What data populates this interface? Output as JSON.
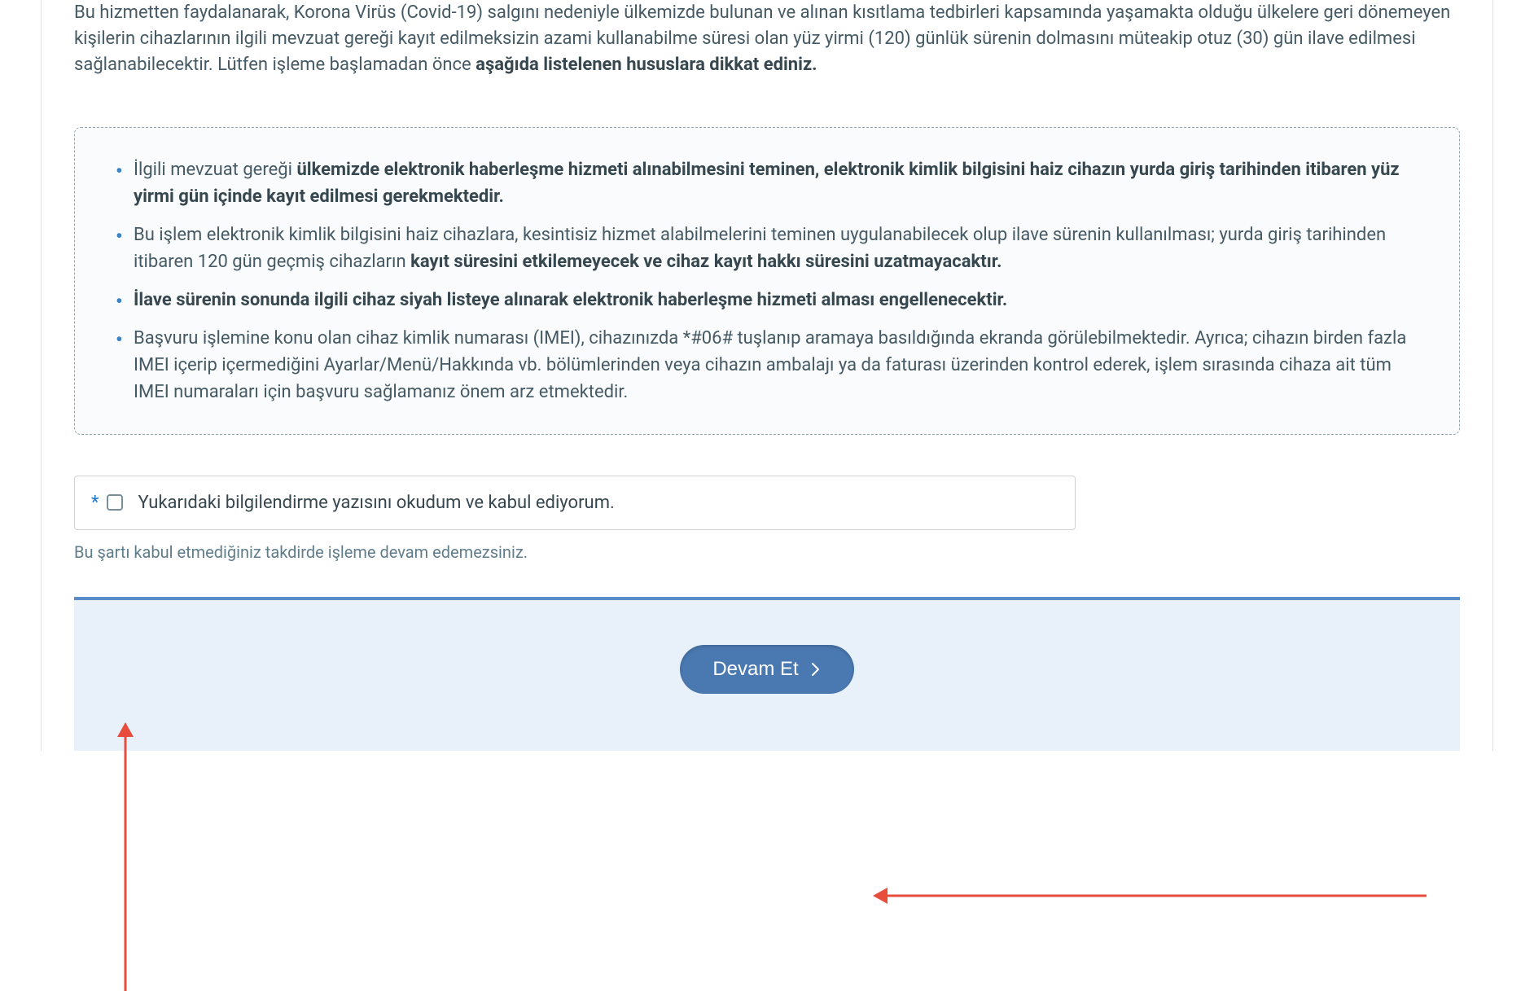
{
  "intro": {
    "text_prefix": "Bu hizmetten faydalanarak, Korona Virüs (Covid-19) salgını nedeniyle ülkemizde bulunan ve alınan kısıtlama tedbirleri kapsamında yaşamakta olduğu ülkelere geri dönemeyen kişilerin cihazlarının ilgili mevzuat gereği kayıt edilmeksizin azami kullanabilme süresi olan yüz yirmi (120) günlük sürenin dolmasını müteakip otuz (30) gün ilave edilmesi sağlanabilecektir. Lütfen işleme başlamadan önce ",
    "text_bold": "aşağıda listelenen hususlara dikkat ediniz."
  },
  "info_items": [
    {
      "prefix": "İlgili mevzuat gereği ",
      "bold": "ülkemizde elektronik haberleşme hizmeti alınabilmesini teminen, elektronik kimlik bilgisini haiz cihazın yurda giriş tarihinden itibaren yüz yirmi gün içinde kayıt edilmesi gerekmektedir.",
      "suffix": ""
    },
    {
      "prefix": "Bu işlem elektronik kimlik bilgisini haiz cihazlara, kesintisiz hizmet alabilmelerini teminen uygulanabilecek olup ilave sürenin kullanılması; yurda giriş tarihinden itibaren 120 gün geçmiş cihazların ",
      "bold": "kayıt süresini etkilemeyecek ve cihaz kayıt hakkı süresini uzatmayacaktır.",
      "suffix": ""
    },
    {
      "prefix": "",
      "bold": "İlave sürenin sonunda ilgili cihaz siyah listeye alınarak elektronik haberleşme hizmeti alması engellenecektir.",
      "suffix": ""
    },
    {
      "prefix": "Başvuru işlemine konu olan cihaz kimlik numarası (IMEI), cihazınızda *#06# tuşlanıp aramaya basıldığında ekranda görülebilmektedir. Ayrıca; cihazın birden fazla IMEI içerip içermediğini Ayarlar/Menü/Hakkında vb. bölümlerinden veya cihazın ambalajı ya da faturası üzerinden kontrol ederek, işlem sırasında cihaza ait tüm IMEI numaraları için başvuru sağlamanız önem arz etmektedir.",
      "bold": "",
      "suffix": ""
    }
  ],
  "checkbox": {
    "required_mark": "*",
    "label": "Yukarıdaki bilgilendirme yazısını okudum ve kabul ediyorum."
  },
  "helper_text": "Bu şartı kabul etmediğiniz takdirde işleme devam edemezsiniz.",
  "continue_button": "Devam Et",
  "colors": {
    "accent": "#4a78b0",
    "bullet": "#3b82c7",
    "annotation": "#e74c3c"
  }
}
